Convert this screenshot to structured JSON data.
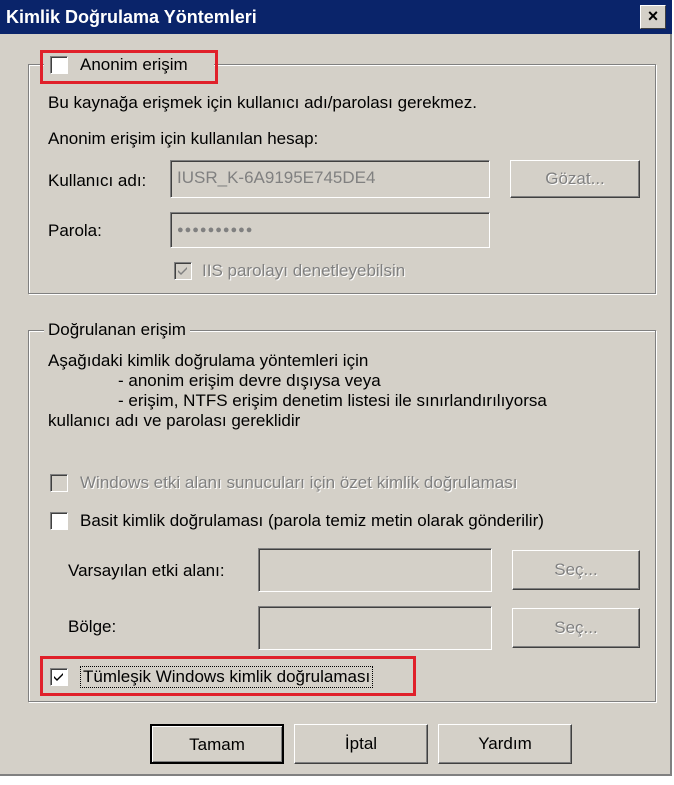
{
  "title": "Kimlik Doğrulama Yöntemleri",
  "close_glyph": "×",
  "anon": {
    "legend": "Anonim erişim",
    "desc": "Bu kaynağa erişmek için kullanıcı adı/parolası gerekmez.",
    "account_label": "Anonim erişim için kullanılan hesap:",
    "username_label": "Kullanıcı adı:",
    "username_value": "IUSR_K-6A9195E745DE4",
    "browse_label": "Gözat...",
    "password_label": "Parola:",
    "password_mask": "●●●●●●●●●●",
    "iis_label": "IIS parolayı denetleyebilsin",
    "checked": false,
    "iis_checked": true
  },
  "auth": {
    "legend": "Doğrulanan erişim",
    "line1": "Aşağıdaki kimlik doğrulama yöntemleri için",
    "line2": "- anonim erişim devre dışıysa veya",
    "line3": "- erişim, NTFS erişim denetim listesi ile sınırlandırılıyorsa",
    "line4": "kullanıcı adı ve parolası gereklidir",
    "digest_label": "Windows etki alanı sunucuları için özet kimlik doğrulaması",
    "basic_label": "Basit kimlik doğrulaması (parola temiz metin olarak gönderilir)",
    "default_domain_label": "Varsayılan etki alanı:",
    "realm_label": "Bölge:",
    "select_label": "Seç...",
    "integrated_label": "Tümleşik Windows kimlik doğrulaması",
    "integrated_checked": true
  },
  "buttons": {
    "ok": "Tamam",
    "cancel": "İptal",
    "help": "Yardım"
  },
  "colors": {
    "titlebar": "#0a246a",
    "face": "#d4d0c8",
    "highlight": "#e0202a"
  }
}
